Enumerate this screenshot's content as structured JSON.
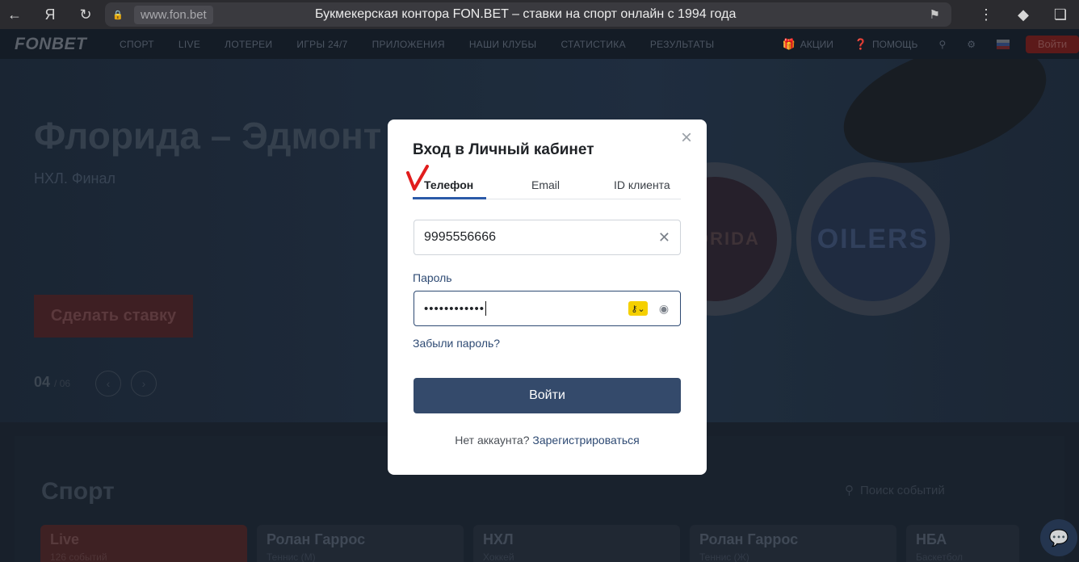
{
  "browser": {
    "url": "www.fon.bet",
    "title": "Букмекерская контора FON.BET – ставки на спорт онлайн с 1994 года"
  },
  "nav": {
    "logo": "FONBET",
    "items": [
      "СПОРТ",
      "LIVE",
      "ЛОТЕРЕИ",
      "ИГРЫ 24/7",
      "ПРИЛОЖЕНИЯ",
      "НАШИ КЛУБЫ",
      "СТАТИСТИКА",
      "РЕЗУЛЬТАТЫ"
    ],
    "promo": "АКЦИИ",
    "help": "ПОМОЩЬ",
    "login": "Войти"
  },
  "hero": {
    "title": "Флорида – Эдмонт",
    "subtitle": "НХЛ. Финал",
    "bet_button": "Сделать ставку",
    "slide_current": "04",
    "slide_total": "/ 06",
    "team_right": "OILERS",
    "team_left": "FLORIDA"
  },
  "lower": {
    "title": "Спорт",
    "search_placeholder": "Поиск событий",
    "cards": [
      {
        "title": "Live",
        "subtitle": "126 событий"
      },
      {
        "title": "Ролан Гаррос",
        "subtitle": "Теннис (М)"
      },
      {
        "title": "НХЛ",
        "subtitle": "Хоккей"
      },
      {
        "title": "Ролан Гаррос",
        "subtitle": "Теннис (Ж)"
      },
      {
        "title": "НБА",
        "subtitle": "Баскетбол"
      }
    ]
  },
  "modal": {
    "title": "Вход в Личный кабинет",
    "tabs": [
      "Телефон",
      "Email",
      "ID клиента"
    ],
    "phone_value": "9995556666",
    "password_label": "Пароль",
    "password_value": "••••••••••••",
    "forgot": "Забыли пароль?",
    "submit": "Войти",
    "no_account": "Нет аккаунта?",
    "register": "Зарегистрироваться"
  },
  "colors": {
    "accent": "#344a6b",
    "link": "#2e4a73",
    "tab_active": "#2b5aa8",
    "checkmark": "#e11d1d"
  }
}
